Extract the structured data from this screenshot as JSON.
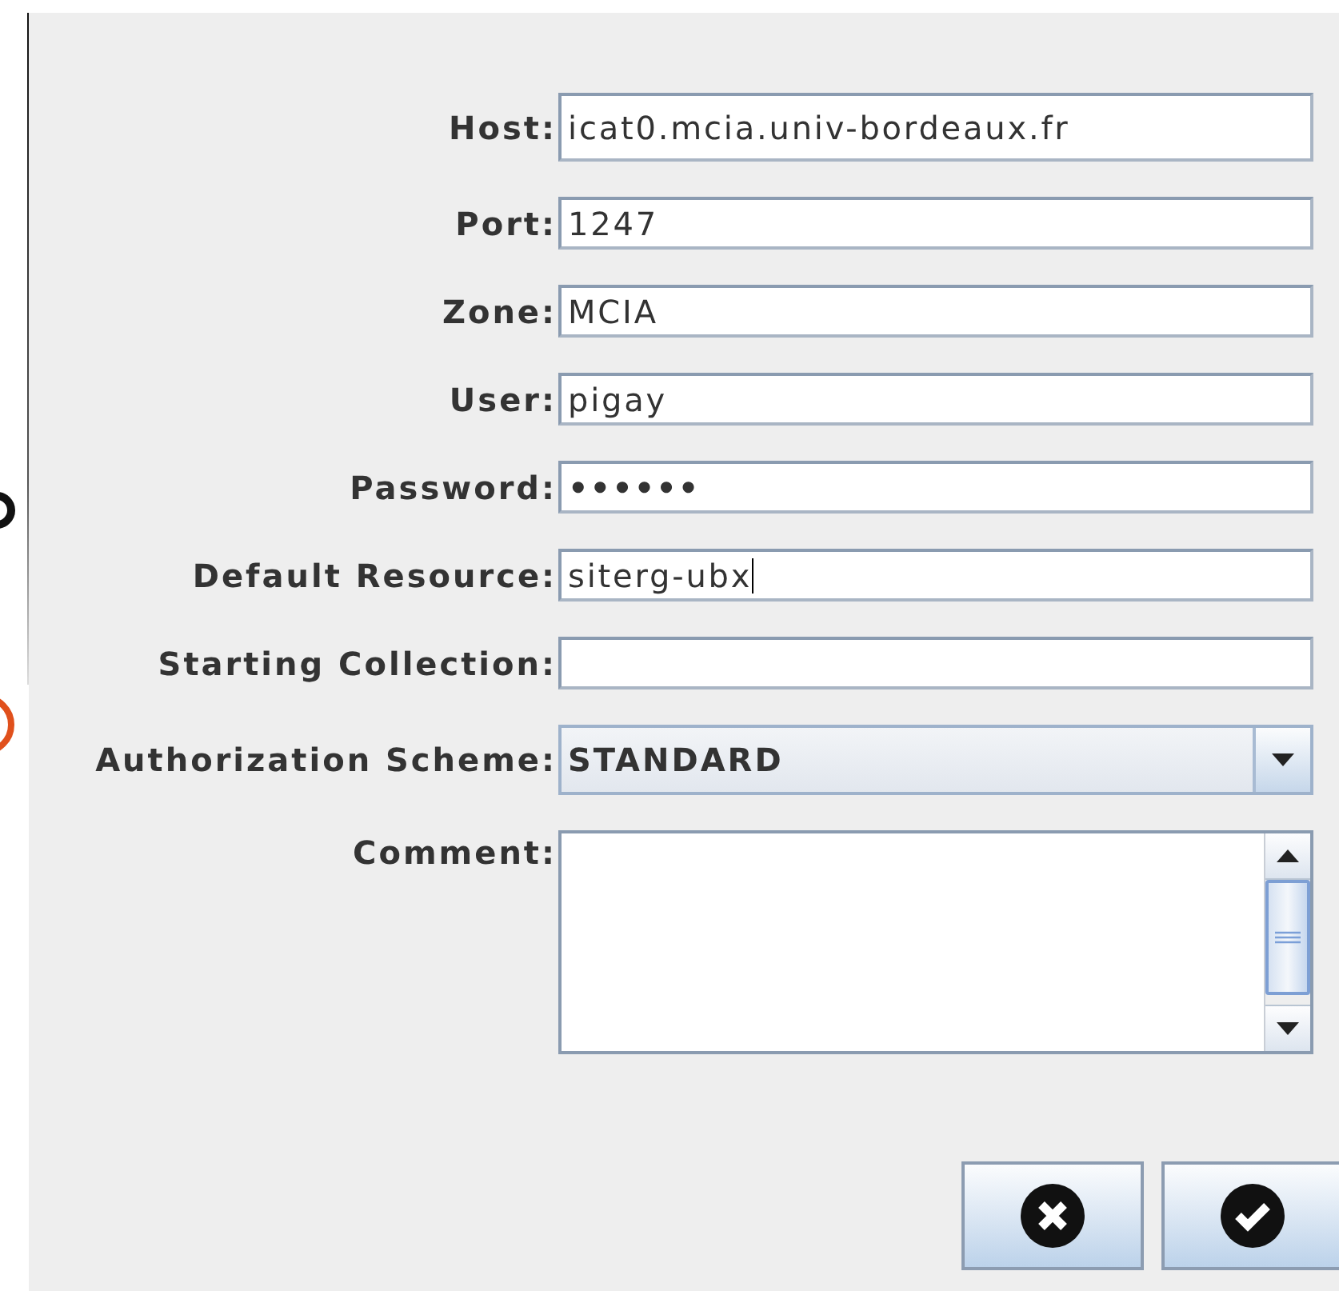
{
  "fields": [
    {
      "kind": "text",
      "label": "Host:",
      "value": "icat0.mcia.univ-bordeaux.fr",
      "focused": false
    },
    {
      "kind": "text",
      "label": "Port:",
      "value": "1247",
      "focused": false
    },
    {
      "kind": "text",
      "label": "Zone:",
      "value": "MCIA",
      "focused": false
    },
    {
      "kind": "text",
      "label": "User:",
      "value": "pigay",
      "focused": false
    },
    {
      "kind": "password",
      "label": "Password:",
      "value": "••••••",
      "focused": false
    },
    {
      "kind": "text",
      "label": "Default Resource:",
      "value": "siterg-ubx",
      "focused": true
    },
    {
      "kind": "text",
      "label": "Starting Collection:",
      "focused": false
    },
    {
      "kind": "combo",
      "label": "Authorization Scheme:",
      "value": "STANDARD"
    },
    {
      "kind": "textarea",
      "label": "Comment:"
    }
  ],
  "buttons": [
    {
      "kind": "cancel"
    },
    {
      "kind": "ok"
    }
  ]
}
